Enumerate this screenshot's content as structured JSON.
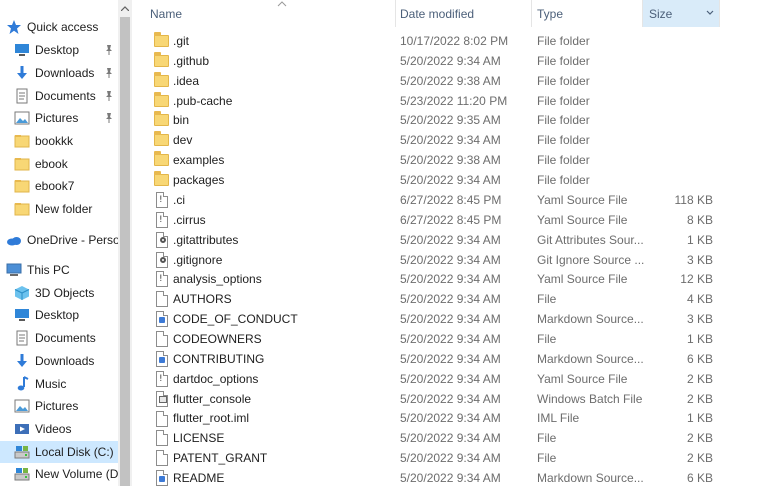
{
  "nav": {
    "items": [
      {
        "label": "Quick access",
        "icon": "star-icon",
        "pinned": false
      },
      {
        "label": "Desktop",
        "icon": "desktop-icon",
        "pinned": true
      },
      {
        "label": "Downloads",
        "icon": "download-arrow-icon",
        "pinned": true
      },
      {
        "label": "Documents",
        "icon": "documents-icon",
        "pinned": true
      },
      {
        "label": "Pictures",
        "icon": "pictures-icon",
        "pinned": true
      },
      {
        "label": "bookkk",
        "icon": "folder-icon",
        "pinned": false
      },
      {
        "label": "ebook",
        "icon": "folder-icon",
        "pinned": false
      },
      {
        "label": "ebook7",
        "icon": "folder-icon",
        "pinned": false
      },
      {
        "label": "New folder",
        "icon": "folder-icon",
        "pinned": false
      },
      {
        "label": "OneDrive - Personal",
        "icon": "cloud-icon",
        "pinned": false
      },
      {
        "label": "This PC",
        "icon": "computer-icon",
        "pinned": false
      },
      {
        "label": "3D Objects",
        "icon": "cube-icon",
        "pinned": false
      },
      {
        "label": "Desktop",
        "icon": "desktop-icon",
        "pinned": false
      },
      {
        "label": "Documents",
        "icon": "documents-icon",
        "pinned": false
      },
      {
        "label": "Downloads",
        "icon": "download-arrow-icon",
        "pinned": false
      },
      {
        "label": "Music",
        "icon": "music-note-icon",
        "pinned": false
      },
      {
        "label": "Pictures",
        "icon": "pictures-icon",
        "pinned": false
      },
      {
        "label": "Videos",
        "icon": "videos-icon",
        "pinned": false
      },
      {
        "label": "Local Disk (C:)",
        "icon": "drive-icon",
        "pinned": false,
        "selected": true
      },
      {
        "label": "New Volume (D:)",
        "icon": "drive-icon",
        "pinned": false
      }
    ]
  },
  "columns": {
    "name": "Name",
    "date": "Date modified",
    "type": "Type",
    "size": "Size"
  },
  "files": [
    {
      "name": ".git",
      "date": "10/17/2022 8:02 PM",
      "type": "File folder",
      "size": "",
      "icon": "folder"
    },
    {
      "name": ".github",
      "date": "5/20/2022 9:34 AM",
      "type": "File folder",
      "size": "",
      "icon": "folder"
    },
    {
      "name": ".idea",
      "date": "5/20/2022 9:38 AM",
      "type": "File folder",
      "size": "",
      "icon": "folder"
    },
    {
      "name": ".pub-cache",
      "date": "5/23/2022 11:20 PM",
      "type": "File folder",
      "size": "",
      "icon": "folder"
    },
    {
      "name": "bin",
      "date": "5/20/2022 9:35 AM",
      "type": "File folder",
      "size": "",
      "icon": "folder"
    },
    {
      "name": "dev",
      "date": "5/20/2022 9:34 AM",
      "type": "File folder",
      "size": "",
      "icon": "folder"
    },
    {
      "name": "examples",
      "date": "5/20/2022 9:38 AM",
      "type": "File folder",
      "size": "",
      "icon": "folder"
    },
    {
      "name": "packages",
      "date": "5/20/2022 9:34 AM",
      "type": "File folder",
      "size": "",
      "icon": "folder"
    },
    {
      "name": ".ci",
      "date": "6/27/2022 8:45 PM",
      "type": "Yaml Source File",
      "size": "118 KB",
      "icon": "yaml"
    },
    {
      "name": ".cirrus",
      "date": "6/27/2022 8:45 PM",
      "type": "Yaml Source File",
      "size": "8 KB",
      "icon": "yaml"
    },
    {
      "name": ".gitattributes",
      "date": "5/20/2022 9:34 AM",
      "type": "Git Attributes Sour...",
      "size": "1 KB",
      "icon": "gear"
    },
    {
      "name": ".gitignore",
      "date": "5/20/2022 9:34 AM",
      "type": "Git Ignore Source ...",
      "size": "3 KB",
      "icon": "gear"
    },
    {
      "name": "analysis_options",
      "date": "5/20/2022 9:34 AM",
      "type": "Yaml Source File",
      "size": "12 KB",
      "icon": "yaml"
    },
    {
      "name": "AUTHORS",
      "date": "5/20/2022 9:34 AM",
      "type": "File",
      "size": "4 KB",
      "icon": "blank"
    },
    {
      "name": "CODE_OF_CONDUCT",
      "date": "5/20/2022 9:34 AM",
      "type": "Markdown Source...",
      "size": "3 KB",
      "icon": "markdown"
    },
    {
      "name": "CODEOWNERS",
      "date": "5/20/2022 9:34 AM",
      "type": "File",
      "size": "1 KB",
      "icon": "blank"
    },
    {
      "name": "CONTRIBUTING",
      "date": "5/20/2022 9:34 AM",
      "type": "Markdown Source...",
      "size": "6 KB",
      "icon": "markdown"
    },
    {
      "name": "dartdoc_options",
      "date": "5/20/2022 9:34 AM",
      "type": "Yaml Source File",
      "size": "2 KB",
      "icon": "yaml"
    },
    {
      "name": "flutter_console",
      "date": "5/20/2022 9:34 AM",
      "type": "Windows Batch File",
      "size": "2 KB",
      "icon": "batch"
    },
    {
      "name": "flutter_root.iml",
      "date": "5/20/2022 9:34 AM",
      "type": "IML File",
      "size": "1 KB",
      "icon": "blank"
    },
    {
      "name": "LICENSE",
      "date": "5/20/2022 9:34 AM",
      "type": "File",
      "size": "2 KB",
      "icon": "blank"
    },
    {
      "name": "PATENT_GRANT",
      "date": "5/20/2022 9:34 AM",
      "type": "File",
      "size": "2 KB",
      "icon": "blank"
    },
    {
      "name": "README",
      "date": "5/20/2022 9:34 AM",
      "type": "Markdown Source...",
      "size": "6 KB",
      "icon": "markdown"
    }
  ]
}
